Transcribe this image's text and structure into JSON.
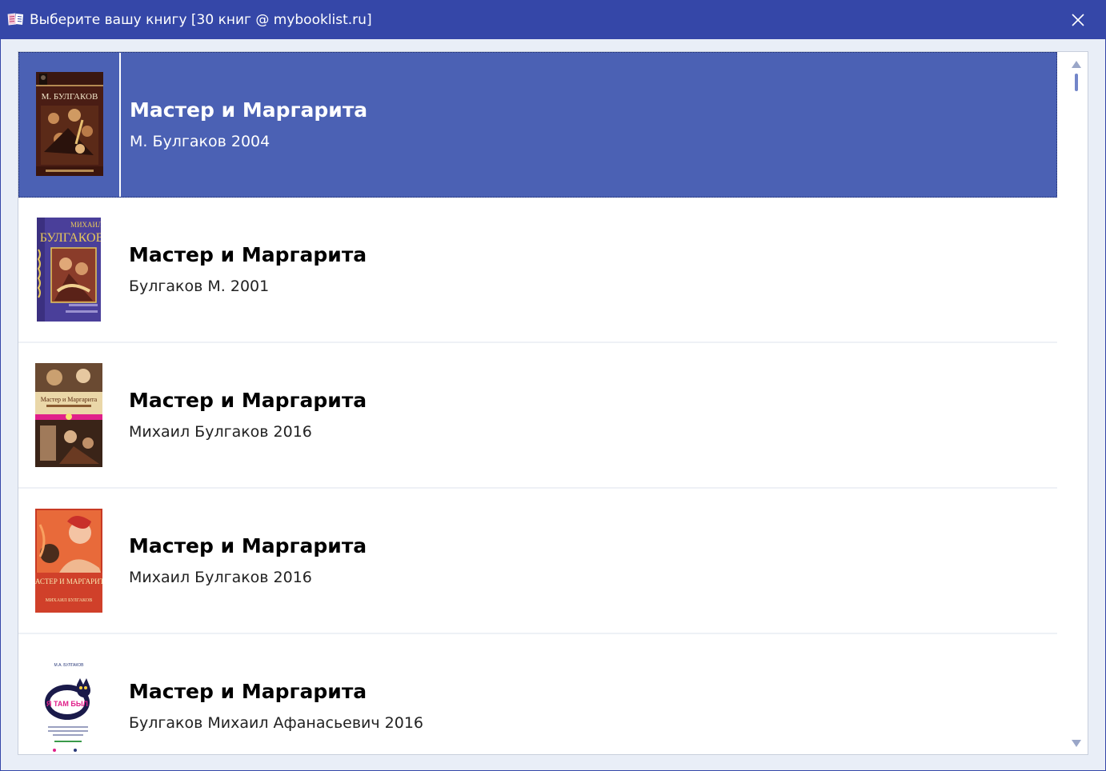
{
  "window": {
    "title": "Выберите вашу книгу [30 книг @ mybooklist.ru]",
    "app_icon": "open-book-icon",
    "close_icon": "close-icon",
    "colors": {
      "titlebar": "#3547a8",
      "selection": "#4b61b4"
    }
  },
  "books": [
    {
      "title": "Мастер и Маргарита",
      "subtitle": "М. Булгаков 2004",
      "cover_text": "М. БУЛГАКОВ",
      "selected": true
    },
    {
      "title": "Мастер и Маргарита",
      "subtitle": "Булгаков М. 2001",
      "cover_text": "БУЛГАКОВ",
      "cover_top_text": "МИХАИЛ",
      "selected": false
    },
    {
      "title": "Мастер и Маргарита",
      "subtitle": "Михаил Булгаков 2016",
      "cover_text": "Мастер и Маргарита",
      "selected": false
    },
    {
      "title": "Мастер и Маргарита",
      "subtitle": "Михаил Булгаков 2016",
      "cover_text": "МАСТЕР И МАРГАРИТА",
      "cover_author": "МИХАИЛ БУЛГАКОВ",
      "selected": false
    },
    {
      "title": "Мастер и Маргарита",
      "subtitle": "Булгаков Михаил Афанасьевич 2016",
      "cover_text": "Я ТАМ БЫЛ",
      "cover_top_text": "М.А. БУЛГАКОВ",
      "selected": false
    }
  ],
  "scrollbar": {
    "up_icon": "scroll-up-arrow-icon",
    "down_icon": "scroll-down-arrow-icon"
  }
}
